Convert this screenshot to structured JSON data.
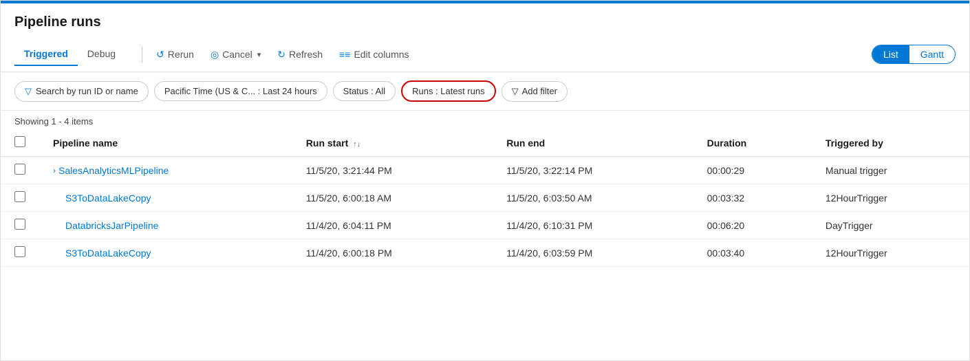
{
  "page": {
    "title": "Pipeline runs",
    "top_bar_color": "#0078d4"
  },
  "toolbar": {
    "tabs": [
      {
        "id": "triggered",
        "label": "Triggered",
        "active": true
      },
      {
        "id": "debug",
        "label": "Debug",
        "active": false
      }
    ],
    "buttons": [
      {
        "id": "rerun",
        "label": "Rerun",
        "icon": "↺"
      },
      {
        "id": "cancel",
        "label": "Cancel",
        "icon": "◎",
        "dropdown": true
      },
      {
        "id": "refresh",
        "label": "Refresh",
        "icon": "↻"
      },
      {
        "id": "edit-columns",
        "label": "Edit columns",
        "icon": "≡≡"
      }
    ],
    "toggle": {
      "options": [
        {
          "id": "list",
          "label": "List",
          "active": true
        },
        {
          "id": "gantt",
          "label": "Gantt",
          "active": false
        }
      ]
    }
  },
  "filters": {
    "search_placeholder": "Search by run ID or name",
    "time_filter": "Pacific Time (US & C...  :  Last 24 hours",
    "status_filter": "Status : All",
    "runs_filter": "Runs : Latest runs",
    "add_filter_label": "Add filter",
    "add_filter_icon": "▽"
  },
  "table": {
    "showing_text": "Showing 1 - 4 items",
    "columns": [
      {
        "id": "checkbox",
        "label": ""
      },
      {
        "id": "pipeline_name",
        "label": "Pipeline name"
      },
      {
        "id": "run_start",
        "label": "Run start",
        "sortable": true
      },
      {
        "id": "run_end",
        "label": "Run end"
      },
      {
        "id": "duration",
        "label": "Duration"
      },
      {
        "id": "triggered_by",
        "label": "Triggered by"
      }
    ],
    "rows": [
      {
        "id": "row1",
        "pipeline_name": "SalesAnalyticsMLPipeline",
        "has_expand": true,
        "run_start": "11/5/20, 3:21:44 PM",
        "run_end": "11/5/20, 3:22:14 PM",
        "duration": "00:00:29",
        "triggered_by": "Manual trigger"
      },
      {
        "id": "row2",
        "pipeline_name": "S3ToDataLakeCopy",
        "has_expand": false,
        "run_start": "11/5/20, 6:00:18 AM",
        "run_end": "11/5/20, 6:03:50 AM",
        "duration": "00:03:32",
        "triggered_by": "12HourTrigger"
      },
      {
        "id": "row3",
        "pipeline_name": "DatabricksJarPipeline",
        "has_expand": false,
        "run_start": "11/4/20, 6:04:11 PM",
        "run_end": "11/4/20, 6:10:31 PM",
        "duration": "00:06:20",
        "triggered_by": "DayTrigger"
      },
      {
        "id": "row4",
        "pipeline_name": "S3ToDataLakeCopy",
        "has_expand": false,
        "run_start": "11/4/20, 6:00:18 PM",
        "run_end": "11/4/20, 6:03:59 PM",
        "duration": "00:03:40",
        "triggered_by": "12HourTrigger"
      }
    ]
  }
}
